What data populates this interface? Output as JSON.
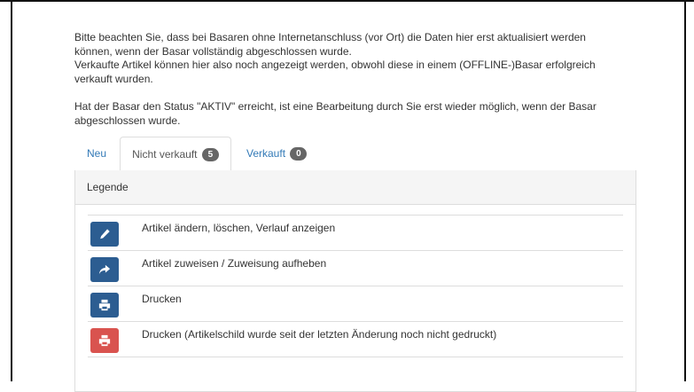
{
  "notice": {
    "line1": "Bitte beachten Sie, dass bei Basaren ohne Internetanschluss (vor Ort) die Daten hier erst aktualisiert werden",
    "line2": "können, wenn der Basar vollständig abgeschlossen wurde.",
    "line3": "Verkaufte Artikel können hier also noch angezeigt werden, obwohl diese in einem (OFFLINE-)Basar erfolgreich",
    "line4": "verkauft wurden.",
    "line5": "Hat der Basar den Status \"AKTIV\" erreicht, ist eine Bearbeitung durch Sie erst wieder möglich, wenn der Basar",
    "line6": "abgeschlossen wurde."
  },
  "tabs": {
    "new": {
      "label": "Neu"
    },
    "unsold": {
      "label": "Nicht verkauft",
      "count": "5"
    },
    "sold": {
      "label": "Verkauft",
      "count": "0"
    }
  },
  "legend": {
    "title": "Legende",
    "items": [
      {
        "icon": "pencil-icon",
        "label": "Artikel ändern, löschen, Verlauf anzeigen",
        "color": "#2c5d91"
      },
      {
        "icon": "share-icon",
        "label": "Artikel zuweisen / Zuweisung aufheben",
        "color": "#2c5d91"
      },
      {
        "icon": "print-icon",
        "label": "Drucken",
        "color": "#2c5d91"
      },
      {
        "icon": "print-icon",
        "label": "Drucken (Artikelschild wurde seit der letzten Änderung noch nicht gedruckt)",
        "color": "#d9534f"
      }
    ]
  }
}
